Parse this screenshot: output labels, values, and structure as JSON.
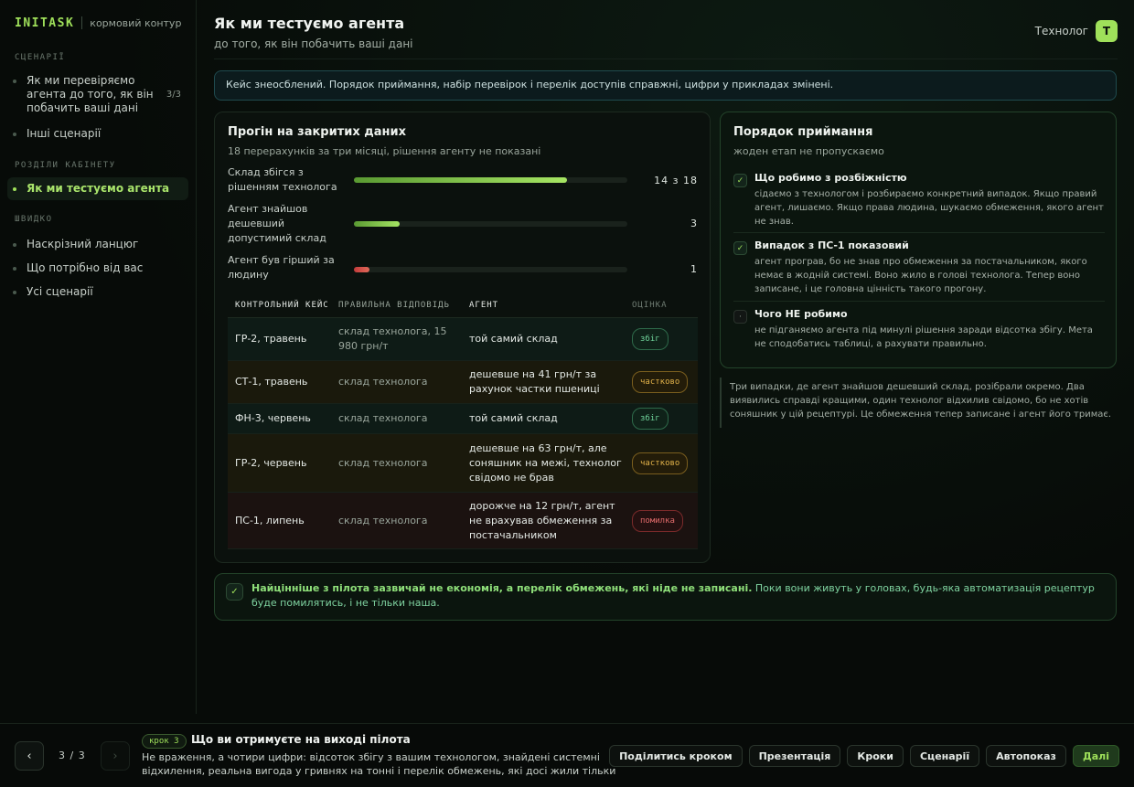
{
  "brand": {
    "name": "INITASK",
    "subtitle": "кормовий контур"
  },
  "sidebar": {
    "section_scenarios": "СЦЕНАРІЇ",
    "scenarios": [
      {
        "label": "Як ми перевіряємо агента до того, як він побачить ваші дані",
        "count": "3/3"
      },
      {
        "label": "Інші сценарії"
      }
    ],
    "section_cabinet": "РОЗДІЛИ КАБІНЕТУ",
    "cabinet": [
      {
        "label": "Як ми тестуємо агента",
        "active": true
      }
    ],
    "section_quick": "ШВИДКО",
    "quick": [
      {
        "label": "Наскрізний ланцюг"
      },
      {
        "label": "Що потрібно від вас"
      },
      {
        "label": "Усі сценарії"
      }
    ]
  },
  "header": {
    "title": "Як ми тестуємо агента",
    "subtitle": "до того, як він побачить ваші дані",
    "user_role": "Технолог",
    "avatar_letter": "Т"
  },
  "notice": "Кейс знеосблений. Порядок приймання, набір перевірок і перелік доступів справжні, цифри у прикладах змінені.",
  "backtest": {
    "title": "Прогін на закритих даних",
    "subtitle": "18 перерахунків за три місяці, рішення агенту не показані",
    "metrics": [
      {
        "label": "Склад збігся з рішенням технолога",
        "value_text": "14 з 18",
        "fraction": 0.7778,
        "tone": "good"
      },
      {
        "label": "Агент знайшов дешевший допустимий склад",
        "value_text": "3",
        "fraction": 0.1667,
        "tone": "good"
      },
      {
        "label": "Агент був гірший за людину",
        "value_text": "1",
        "fraction": 0.0556,
        "tone": "bad"
      }
    ],
    "columns": [
      "КОНТРОЛЬНИЙ КЕЙС",
      "ПРАВИЛЬНА ВІДПОВІДЬ",
      "АГЕНТ",
      "ОЦІНКА"
    ],
    "rows": [
      {
        "case": "ГР-2, травень",
        "answer": "склад технолога, 15 980 грн/т",
        "agent": "той самий склад",
        "grade": "збіг",
        "status": "match"
      },
      {
        "case": "СТ-1, травень",
        "answer": "склад технолога",
        "agent": "дешевше на 41 грн/т за рахунок частки пшениці",
        "grade": "частково",
        "status": "partial"
      },
      {
        "case": "ФН-3, червень",
        "answer": "склад технолога",
        "agent": "той самий склад",
        "grade": "збіг",
        "status": "match"
      },
      {
        "case": "ГР-2, червень",
        "answer": "склад технолога",
        "agent": "дешевше на 63 грн/т, але соняшник на межі, технолог свідомо не брав",
        "grade": "частково",
        "status": "partial"
      },
      {
        "case": "ПС-1, липень",
        "answer": "склад технолога",
        "agent": "дорожче на 12 грн/т, агент не врахував обмеження за постачальником",
        "grade": "помилка",
        "status": "error"
      }
    ]
  },
  "acceptance": {
    "title": "Порядок приймання",
    "subtitle": "жоден етап не пропускаємо",
    "steps": [
      {
        "icon": "check-icon",
        "glyph": "✓",
        "title": "Що робимо з розбіжністю",
        "text": "сідаємо з технологом і розбираємо конкретний випадок. Якщо правий агент, лишаємо. Якщо права людина, шукаємо обмеження, якого агент не знав."
      },
      {
        "icon": "check-icon",
        "glyph": "✓",
        "title": "Випадок з ПС-1 показовий",
        "text": "агент програв, бо не знав про обмеження за постачальником, якого немає в жодній системі. Воно жило в голові технолога. Тепер воно записане, і це головна цінність такого прогону."
      },
      {
        "icon": "dot-icon",
        "glyph": "·",
        "title": "Чого НЕ робимо",
        "text": "не підганяємо агента під минулі рішення заради відсотка збігу. Мета не сподобатись таблиці, а рахувати правильно."
      }
    ]
  },
  "note": "Три випадки, де агент знайшов дешевший склад, розібрали окремо. Два виявились справді кращими, один технолог відхилив свідомо, бо не хотів соняшник у цій рецептурі. Це обмеження тепер записане і агент його тримає.",
  "insight": {
    "bold": "Найцінніше з пілота зазвичай не економія, а перелік обмежень, які ніде не записані.",
    "rest": " Поки вони живуть у головах, будь-яка автоматизація рецептур буде помилятись, і не тільки наша."
  },
  "bottom": {
    "prev": "‹",
    "next": "›",
    "counter": "3 / 3",
    "step_label": "крок 3",
    "title": "Що ви отримуєте на виході пілота",
    "description": "Не враження, а чотири цифри: відсоток збігу з вашим технологом, знайдені системні відхилення, реальна вигода у гривнях на тонні і перелік обмежень, які досі жили тільки ...",
    "actions": [
      "Поділитись кроком",
      "Презентація",
      "Кроки",
      "Сценарії",
      "Автопоказ"
    ],
    "primary": "Далі"
  },
  "colors": {
    "accent": "#9fe05a",
    "match": "#6fd39a",
    "partial": "#e3b34a",
    "error": "#e06a6a"
  }
}
